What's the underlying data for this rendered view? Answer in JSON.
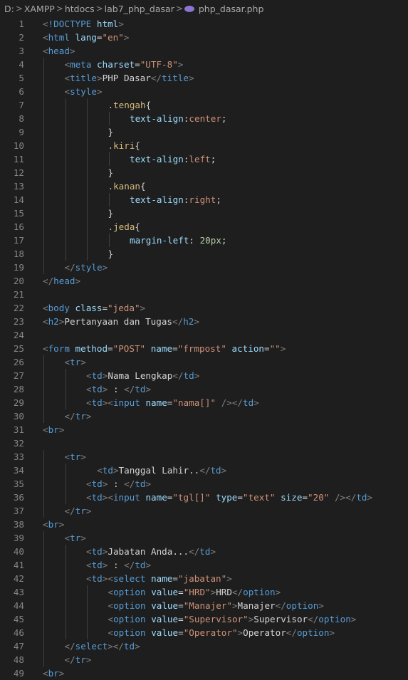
{
  "breadcrumb": {
    "items": [
      "D:",
      "XAMPP",
      "htdocs",
      "lab7_php_dasar",
      "php_dasar.php"
    ],
    "separator": ">",
    "file_icon": "php-elephant-icon"
  },
  "colors": {
    "background": "#1e1e1e",
    "tag": "#569cd6",
    "attribute": "#9cdcfe",
    "string": "#ce9178",
    "bracket": "#808080",
    "text": "#d4d4d4",
    "css_selector": "#d7ba7d",
    "number": "#b5cea8",
    "line_number": "#858585"
  },
  "lines": [
    {
      "n": "1",
      "indent": 0,
      "tokens": [
        [
          "p",
          "<"
        ],
        [
          "t",
          "!DOCTYPE"
        ],
        [
          "txt",
          " "
        ],
        [
          "a",
          "html"
        ],
        [
          "p",
          ">"
        ]
      ]
    },
    {
      "n": "2",
      "indent": 0,
      "tokens": [
        [
          "p",
          "<"
        ],
        [
          "t",
          "html"
        ],
        [
          "txt",
          " "
        ],
        [
          "a",
          "lang"
        ],
        [
          "txt",
          "="
        ],
        [
          "s",
          "\"en\""
        ],
        [
          "p",
          ">"
        ]
      ]
    },
    {
      "n": "3",
      "indent": 0,
      "tokens": [
        [
          "p",
          "<"
        ],
        [
          "t",
          "head"
        ],
        [
          "p",
          ">"
        ]
      ]
    },
    {
      "n": "4",
      "indent": 1,
      "tokens": [
        [
          "p",
          "<"
        ],
        [
          "t",
          "meta"
        ],
        [
          "txt",
          " "
        ],
        [
          "a",
          "charset"
        ],
        [
          "txt",
          "="
        ],
        [
          "s",
          "\"UTF-8\""
        ],
        [
          "p",
          ">"
        ]
      ]
    },
    {
      "n": "5",
      "indent": 1,
      "tokens": [
        [
          "p",
          "<"
        ],
        [
          "t",
          "title"
        ],
        [
          "p",
          ">"
        ],
        [
          "txt",
          "PHP Dasar"
        ],
        [
          "p",
          "</"
        ],
        [
          "t",
          "title"
        ],
        [
          "p",
          ">"
        ]
      ]
    },
    {
      "n": "6",
      "indent": 1,
      "tokens": [
        [
          "p",
          "<"
        ],
        [
          "t",
          "style"
        ],
        [
          "p",
          ">"
        ]
      ]
    },
    {
      "n": "7",
      "indent": 3,
      "tokens": [
        [
          "sel",
          ".tengah"
        ],
        [
          "txt",
          "{"
        ]
      ]
    },
    {
      "n": "8",
      "indent": 4,
      "tokens": [
        [
          "prop",
          "text-align"
        ],
        [
          "txt",
          ":"
        ],
        [
          "s",
          "center"
        ],
        [
          "txt",
          ";"
        ]
      ]
    },
    {
      "n": "9",
      "indent": 3,
      "tokens": [
        [
          "txt",
          "}"
        ]
      ]
    },
    {
      "n": "10",
      "indent": 3,
      "tokens": [
        [
          "sel",
          ".kiri"
        ],
        [
          "txt",
          "{"
        ]
      ]
    },
    {
      "n": "11",
      "indent": 4,
      "tokens": [
        [
          "prop",
          "text-align"
        ],
        [
          "txt",
          ":"
        ],
        [
          "s",
          "left"
        ],
        [
          "txt",
          ";"
        ]
      ]
    },
    {
      "n": "12",
      "indent": 3,
      "tokens": [
        [
          "txt",
          "}"
        ]
      ]
    },
    {
      "n": "13",
      "indent": 3,
      "tokens": [
        [
          "sel",
          ".kanan"
        ],
        [
          "txt",
          "{"
        ]
      ]
    },
    {
      "n": "14",
      "indent": 4,
      "tokens": [
        [
          "prop",
          "text-align"
        ],
        [
          "txt",
          ":"
        ],
        [
          "s",
          "right"
        ],
        [
          "txt",
          ";"
        ]
      ]
    },
    {
      "n": "15",
      "indent": 3,
      "tokens": [
        [
          "txt",
          "}"
        ]
      ]
    },
    {
      "n": "16",
      "indent": 3,
      "tokens": [
        [
          "sel",
          ".jeda"
        ],
        [
          "txt",
          "{"
        ]
      ]
    },
    {
      "n": "17",
      "indent": 4,
      "tokens": [
        [
          "prop",
          "margin-left"
        ],
        [
          "txt",
          ": "
        ],
        [
          "num",
          "20px"
        ],
        [
          "txt",
          ";"
        ]
      ]
    },
    {
      "n": "18",
      "indent": 3,
      "tokens": [
        [
          "txt",
          "}"
        ]
      ]
    },
    {
      "n": "19",
      "indent": 1,
      "tokens": [
        [
          "p",
          "</"
        ],
        [
          "t",
          "style"
        ],
        [
          "p",
          ">"
        ]
      ]
    },
    {
      "n": "20",
      "indent": 0,
      "tokens": [
        [
          "p",
          "</"
        ],
        [
          "t",
          "head"
        ],
        [
          "p",
          ">"
        ]
      ]
    },
    {
      "n": "21",
      "indent": 0,
      "tokens": []
    },
    {
      "n": "22",
      "indent": 0,
      "tokens": [
        [
          "p",
          "<"
        ],
        [
          "t",
          "body"
        ],
        [
          "txt",
          " "
        ],
        [
          "a",
          "class"
        ],
        [
          "txt",
          "="
        ],
        [
          "s",
          "\"jeda\""
        ],
        [
          "p",
          ">"
        ]
      ]
    },
    {
      "n": "23",
      "indent": 0,
      "tokens": [
        [
          "p",
          "<"
        ],
        [
          "t",
          "h2"
        ],
        [
          "p",
          ">"
        ],
        [
          "txt",
          "Pertanyaan dan Tugas"
        ],
        [
          "p",
          "</"
        ],
        [
          "t",
          "h2"
        ],
        [
          "p",
          ">"
        ]
      ]
    },
    {
      "n": "24",
      "indent": 0,
      "tokens": []
    },
    {
      "n": "25",
      "indent": 0,
      "tokens": [
        [
          "p",
          "<"
        ],
        [
          "t",
          "form"
        ],
        [
          "txt",
          " "
        ],
        [
          "a",
          "method"
        ],
        [
          "txt",
          "="
        ],
        [
          "s",
          "\"POST\""
        ],
        [
          "txt",
          " "
        ],
        [
          "a",
          "name"
        ],
        [
          "txt",
          "="
        ],
        [
          "s",
          "\"frmpost\""
        ],
        [
          "txt",
          " "
        ],
        [
          "a",
          "action"
        ],
        [
          "txt",
          "="
        ],
        [
          "s",
          "\"\""
        ],
        [
          "p",
          ">"
        ]
      ]
    },
    {
      "n": "26",
      "indent": 1,
      "tokens": [
        [
          "p",
          "<"
        ],
        [
          "t",
          "tr"
        ],
        [
          "p",
          ">"
        ]
      ]
    },
    {
      "n": "27",
      "indent": 2,
      "tokens": [
        [
          "p",
          "<"
        ],
        [
          "t",
          "td"
        ],
        [
          "p",
          ">"
        ],
        [
          "txt",
          "Nama Lengkap"
        ],
        [
          "p",
          "</"
        ],
        [
          "t",
          "td"
        ],
        [
          "p",
          ">"
        ]
      ]
    },
    {
      "n": "28",
      "indent": 2,
      "tokens": [
        [
          "p",
          "<"
        ],
        [
          "t",
          "td"
        ],
        [
          "p",
          ">"
        ],
        [
          "txt",
          " : "
        ],
        [
          "p",
          "</"
        ],
        [
          "t",
          "td"
        ],
        [
          "p",
          ">"
        ]
      ]
    },
    {
      "n": "29",
      "indent": 2,
      "tokens": [
        [
          "p",
          "<"
        ],
        [
          "t",
          "td"
        ],
        [
          "p",
          "><"
        ],
        [
          "t",
          "input"
        ],
        [
          "txt",
          " "
        ],
        [
          "a",
          "name"
        ],
        [
          "txt",
          "="
        ],
        [
          "s",
          "\"nama[]\""
        ],
        [
          "txt",
          " "
        ],
        [
          "p",
          "/></"
        ],
        [
          "t",
          "td"
        ],
        [
          "p",
          ">"
        ]
      ]
    },
    {
      "n": "30",
      "indent": 1,
      "tokens": [
        [
          "p",
          "</"
        ],
        [
          "t",
          "tr"
        ],
        [
          "p",
          ">"
        ]
      ]
    },
    {
      "n": "31",
      "indent": 0,
      "tokens": [
        [
          "p",
          "<"
        ],
        [
          "t",
          "br"
        ],
        [
          "p",
          ">"
        ]
      ]
    },
    {
      "n": "32",
      "indent": 0,
      "tokens": []
    },
    {
      "n": "33",
      "indent": 1,
      "tokens": [
        [
          "p",
          "<"
        ],
        [
          "t",
          "tr"
        ],
        [
          "p",
          ">"
        ]
      ]
    },
    {
      "n": "34",
      "indent": 2,
      "tokens": [
        [
          "txt",
          "  "
        ],
        [
          "p",
          "<"
        ],
        [
          "t",
          "td"
        ],
        [
          "p",
          ">"
        ],
        [
          "txt",
          "Tanggal Lahir.."
        ],
        [
          "p",
          "</"
        ],
        [
          "t",
          "td"
        ],
        [
          "p",
          ">"
        ]
      ]
    },
    {
      "n": "35",
      "indent": 2,
      "tokens": [
        [
          "p",
          "<"
        ],
        [
          "t",
          "td"
        ],
        [
          "p",
          ">"
        ],
        [
          "txt",
          " : "
        ],
        [
          "p",
          "</"
        ],
        [
          "t",
          "td"
        ],
        [
          "p",
          ">"
        ]
      ]
    },
    {
      "n": "36",
      "indent": 2,
      "tokens": [
        [
          "p",
          "<"
        ],
        [
          "t",
          "td"
        ],
        [
          "p",
          "><"
        ],
        [
          "t",
          "input"
        ],
        [
          "txt",
          " "
        ],
        [
          "a",
          "name"
        ],
        [
          "txt",
          "="
        ],
        [
          "s",
          "\"tgl[]\""
        ],
        [
          "txt",
          " "
        ],
        [
          "a",
          "type"
        ],
        [
          "txt",
          "="
        ],
        [
          "s",
          "\"text\""
        ],
        [
          "txt",
          " "
        ],
        [
          "a",
          "size"
        ],
        [
          "txt",
          "="
        ],
        [
          "s",
          "\"20\""
        ],
        [
          "txt",
          " "
        ],
        [
          "p",
          "/></"
        ],
        [
          "t",
          "td"
        ],
        [
          "p",
          ">"
        ]
      ]
    },
    {
      "n": "37",
      "indent": 1,
      "tokens": [
        [
          "p",
          "</"
        ],
        [
          "t",
          "tr"
        ],
        [
          "p",
          ">"
        ]
      ]
    },
    {
      "n": "38",
      "indent": 0,
      "tokens": [
        [
          "p",
          "<"
        ],
        [
          "t",
          "br"
        ],
        [
          "p",
          ">"
        ]
      ]
    },
    {
      "n": "39",
      "indent": 1,
      "tokens": [
        [
          "p",
          "<"
        ],
        [
          "t",
          "tr"
        ],
        [
          "p",
          ">"
        ]
      ]
    },
    {
      "n": "40",
      "indent": 2,
      "tokens": [
        [
          "p",
          "<"
        ],
        [
          "t",
          "td"
        ],
        [
          "p",
          ">"
        ],
        [
          "txt",
          "Jabatan Anda..."
        ],
        [
          "p",
          "</"
        ],
        [
          "t",
          "td"
        ],
        [
          "p",
          ">"
        ]
      ]
    },
    {
      "n": "41",
      "indent": 2,
      "tokens": [
        [
          "p",
          "<"
        ],
        [
          "t",
          "td"
        ],
        [
          "p",
          ">"
        ],
        [
          "txt",
          " : "
        ],
        [
          "p",
          "</"
        ],
        [
          "t",
          "td"
        ],
        [
          "p",
          ">"
        ]
      ]
    },
    {
      "n": "42",
      "indent": 2,
      "tokens": [
        [
          "p",
          "<"
        ],
        [
          "t",
          "td"
        ],
        [
          "p",
          "><"
        ],
        [
          "t",
          "select"
        ],
        [
          "txt",
          " "
        ],
        [
          "a",
          "name"
        ],
        [
          "txt",
          "="
        ],
        [
          "s",
          "\"jabatan\""
        ],
        [
          "p",
          ">"
        ]
      ]
    },
    {
      "n": "43",
      "indent": 3,
      "tokens": [
        [
          "p",
          "<"
        ],
        [
          "t",
          "option"
        ],
        [
          "txt",
          " "
        ],
        [
          "a",
          "value"
        ],
        [
          "txt",
          "="
        ],
        [
          "s",
          "\"HRD\""
        ],
        [
          "p",
          ">"
        ],
        [
          "txt",
          "HRD"
        ],
        [
          "p",
          "</"
        ],
        [
          "t",
          "option"
        ],
        [
          "p",
          ">"
        ]
      ]
    },
    {
      "n": "44",
      "indent": 3,
      "tokens": [
        [
          "p",
          "<"
        ],
        [
          "t",
          "option"
        ],
        [
          "txt",
          " "
        ],
        [
          "a",
          "value"
        ],
        [
          "txt",
          "="
        ],
        [
          "s",
          "\"Manajer\""
        ],
        [
          "p",
          ">"
        ],
        [
          "txt",
          "Manajer"
        ],
        [
          "p",
          "</"
        ],
        [
          "t",
          "option"
        ],
        [
          "p",
          ">"
        ]
      ]
    },
    {
      "n": "45",
      "indent": 3,
      "tokens": [
        [
          "p",
          "<"
        ],
        [
          "t",
          "option"
        ],
        [
          "txt",
          " "
        ],
        [
          "a",
          "value"
        ],
        [
          "txt",
          "="
        ],
        [
          "s",
          "\"Supervisor\""
        ],
        [
          "p",
          ">"
        ],
        [
          "txt",
          "Supervisor"
        ],
        [
          "p",
          "</"
        ],
        [
          "t",
          "option"
        ],
        [
          "p",
          ">"
        ]
      ]
    },
    {
      "n": "46",
      "indent": 3,
      "tokens": [
        [
          "p",
          "<"
        ],
        [
          "t",
          "option"
        ],
        [
          "txt",
          " "
        ],
        [
          "a",
          "value"
        ],
        [
          "txt",
          "="
        ],
        [
          "s",
          "\"Operator\""
        ],
        [
          "p",
          ">"
        ],
        [
          "txt",
          "Operator"
        ],
        [
          "p",
          "</"
        ],
        [
          "t",
          "option"
        ],
        [
          "p",
          ">"
        ]
      ]
    },
    {
      "n": "47",
      "indent": 1,
      "tokens": [
        [
          "p",
          "</"
        ],
        [
          "t",
          "select"
        ],
        [
          "p",
          "></"
        ],
        [
          "t",
          "td"
        ],
        [
          "p",
          ">"
        ]
      ]
    },
    {
      "n": "48",
      "indent": 1,
      "tokens": [
        [
          "p",
          "</"
        ],
        [
          "t",
          "tr"
        ],
        [
          "p",
          ">"
        ]
      ]
    },
    {
      "n": "49",
      "indent": 0,
      "tokens": [
        [
          "p",
          "<"
        ],
        [
          "t",
          "br"
        ],
        [
          "p",
          ">"
        ]
      ]
    }
  ]
}
